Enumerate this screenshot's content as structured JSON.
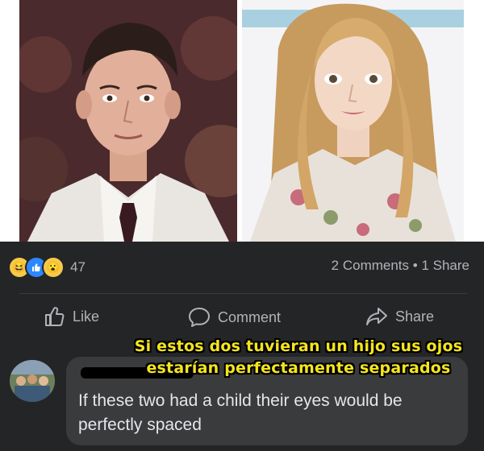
{
  "reactions": {
    "icons": [
      "haha-icon",
      "like-icon",
      "wow-icon"
    ],
    "count": "47"
  },
  "stats": {
    "comments": "2 Comments",
    "separator": "•",
    "shares": "1 Share"
  },
  "actions": {
    "like": "Like",
    "comment": "Comment",
    "share": "Share"
  },
  "overlay": {
    "line1": "Si estos dos tuvieran un hijo sus ojos",
    "line2": "estarían perfectamente separados"
  },
  "comment": {
    "text": "If these two had a child their eyes would be perfectly spaced"
  },
  "colors": {
    "post_bg": "#242526",
    "bubble_bg": "#3a3b3c",
    "text_secondary": "#b0b3b8",
    "overlay_text": "#f5e51e",
    "like_blue": "#2d88ff"
  }
}
